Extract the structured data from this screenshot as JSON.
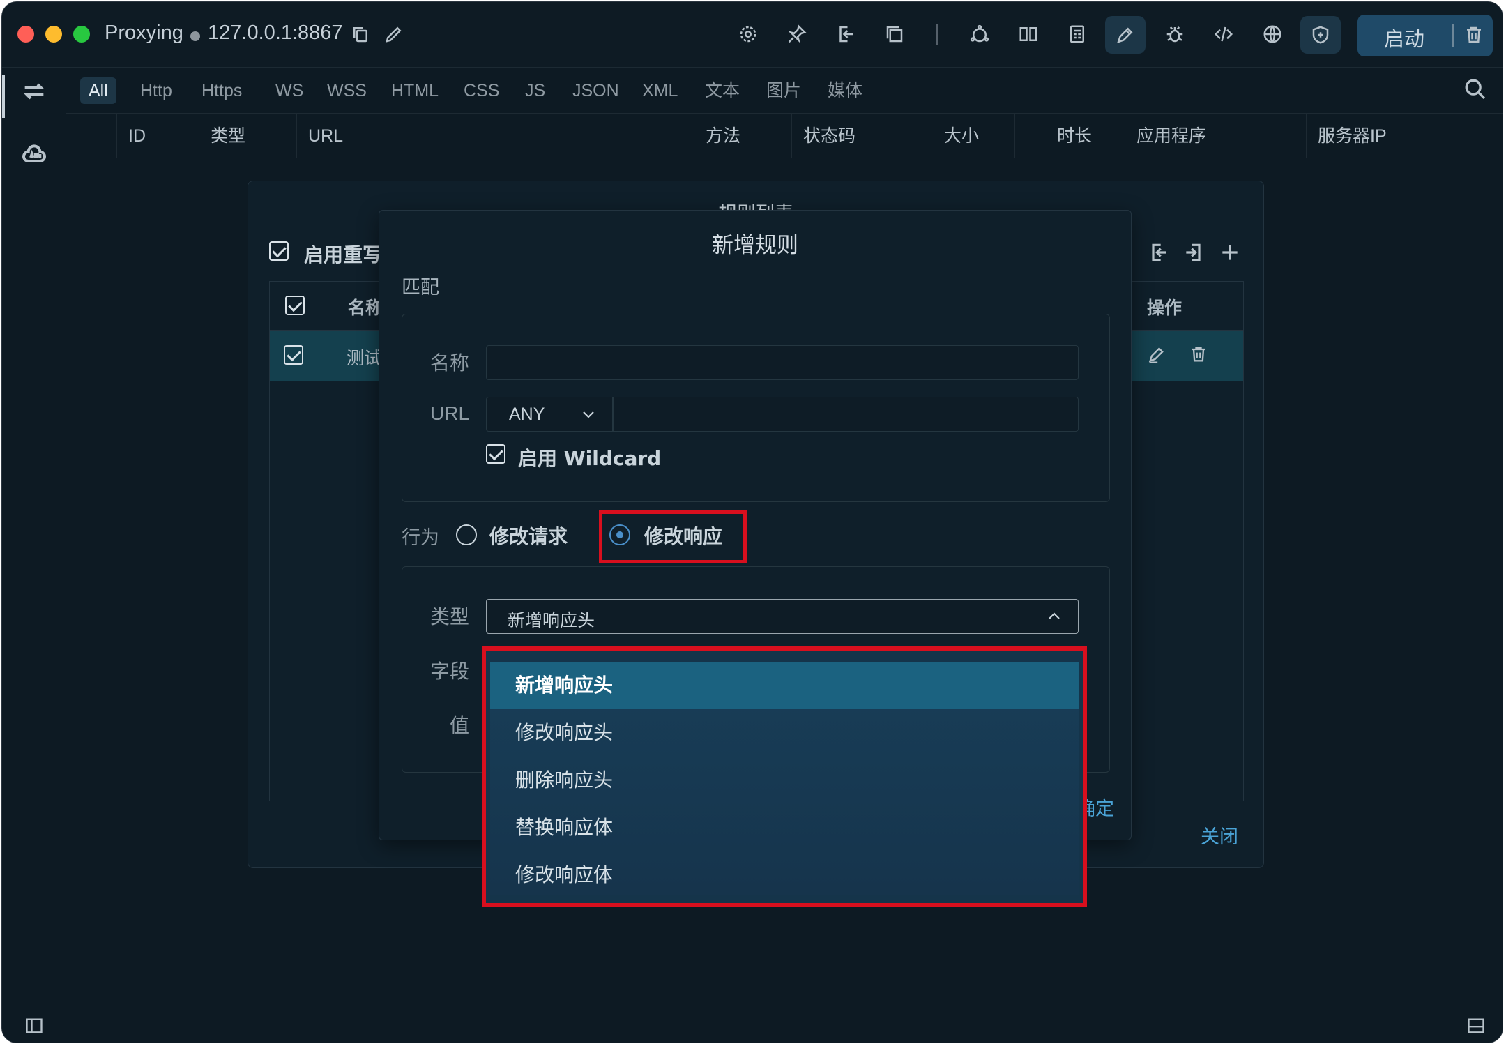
{
  "window": {
    "app_name": "Proxying",
    "address": "127.0.0.1:8867"
  },
  "toolbar": {
    "start_label": "启动",
    "icons": [
      "settings-icon",
      "pin-icon",
      "export-icon",
      "window-icon",
      "nat-icon",
      "split-icon",
      "calculator-icon",
      "pen-icon",
      "bug-icon",
      "code-icon",
      "globe-icon",
      "shield-icon"
    ]
  },
  "filters": {
    "tabs": [
      "All",
      "Http",
      "Https",
      "WS",
      "WSS",
      "HTML",
      "CSS",
      "JS",
      "JSON",
      "XML",
      "文本",
      "图片",
      "媒体"
    ],
    "active": "All"
  },
  "columns": [
    "ID",
    "类型",
    "URL",
    "方法",
    "状态码",
    "大小",
    "时长",
    "应用程序",
    "服务器IP"
  ],
  "rule_list": {
    "title": "规则列表",
    "enable_rewrite": "启用重写",
    "header_name": "名称",
    "header_action": "操作",
    "row_name": "测试",
    "close_label": "关闭"
  },
  "add_rule": {
    "title": "新增规则",
    "match_label": "匹配",
    "name_label": "名称",
    "name_value": "",
    "url_label": "URL",
    "url_method": "ANY",
    "url_value": "",
    "wildcard_label": "启用 Wildcard",
    "behavior_label": "行为",
    "behavior_request": "修改请求",
    "behavior_response": "修改响应",
    "type_label": "类型",
    "type_value": "新增响应头",
    "field_label": "字段",
    "value_label": "值",
    "confirm_partial": "确定"
  },
  "type_options": [
    "新增响应头",
    "修改响应头",
    "删除响应头",
    "替换响应体",
    "修改响应体"
  ],
  "type_selected_index": 0,
  "colors": {
    "background": "#0d1a23",
    "accent": "#4aa3d6",
    "highlight_box": "#d80f1e",
    "selected_row": "#14404e"
  }
}
